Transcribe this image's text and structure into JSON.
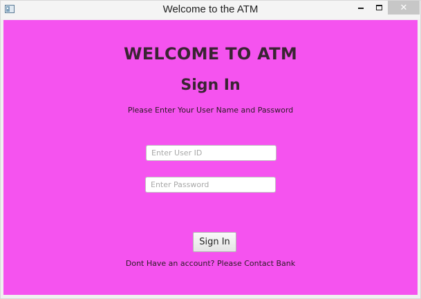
{
  "window": {
    "title": "Welcome to the ATM",
    "icon": "java-app-icon",
    "controls": {
      "minimize_icon": "minimize-icon",
      "maximize_icon": "maximize-icon",
      "close_label": "✕"
    }
  },
  "content": {
    "background_color": "#f553ef",
    "headline": "WELCOME TO ATM",
    "subhead": "Sign In",
    "instruction": "Please Enter Your User Name and Password",
    "user_id": {
      "placeholder": "Enter User ID",
      "value": ""
    },
    "password": {
      "placeholder": "Enter Password",
      "value": ""
    },
    "sign_in_label": "Sign In",
    "footer": "Dont Have an account? Please Contact Bank"
  }
}
